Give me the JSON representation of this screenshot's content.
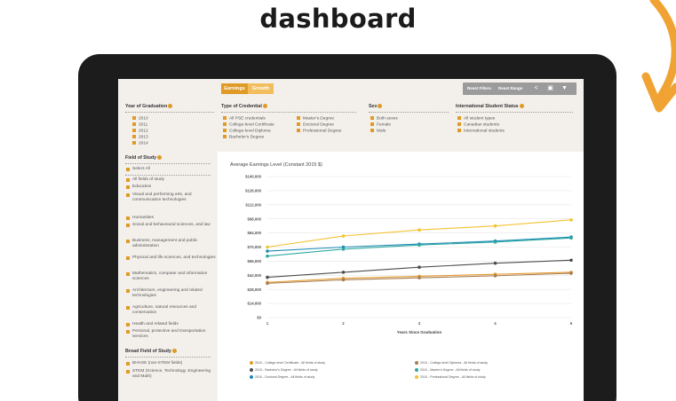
{
  "hero": {
    "title": "dashboard"
  },
  "toolbar": {
    "tabs": [
      {
        "label": "Earnings"
      },
      {
        "label": "Growth"
      }
    ],
    "reset_filters": "Reset Filters",
    "reset_range": "Reset Range",
    "icons": [
      "share-icon",
      "print-icon",
      "download-icon"
    ]
  },
  "filters": {
    "year": {
      "heading": "Year of Graduation",
      "options": [
        "2010",
        "2011",
        "2012",
        "2013",
        "2014"
      ]
    },
    "credential": {
      "heading": "Type of Credential",
      "options": [
        "All PSE credentials",
        "College-level Certificate",
        "College-level Diploma",
        "Bachelor's Degree",
        "Master's Degree",
        "Doctoral Degree",
        "Professional Degree"
      ]
    },
    "sex": {
      "heading": "Sex",
      "options": [
        "Both sexes",
        "Female",
        "Male"
      ]
    },
    "status": {
      "heading": "International Student Status",
      "options": [
        "All student types",
        "Canadian students",
        "International students"
      ]
    }
  },
  "sidebar": {
    "field_heading": "Field of Study",
    "field_options": [
      "Select All",
      "All fields of study",
      "Education",
      "Visual and performing arts, and communication technologies",
      "Humanities",
      "Social and behavioural sciences, and law",
      "Business, management and public administration",
      "Physical and life sciences, and technologies",
      "Mathematics, computer and information sciences",
      "Architecture, engineering and related technologies",
      "Agriculture, natural resources and conservation",
      "Health and related fields",
      "Personal, protective and transportation services"
    ],
    "broad_heading": "Broad Field of Study",
    "broad_options": [
      "BHASE (non-STEM fields)",
      "STEM (Science, Technology, Engineering and Math)"
    ]
  },
  "colors": {
    "accent": "#e09a26",
    "accent_light": "#f2bd5c",
    "panel_bg": "#f3f0ec",
    "laptop": "#1c1c1c",
    "deco_arrow": "#f0a332"
  },
  "chart_data": {
    "type": "line",
    "title": "Average Earnings Level (Constant 2015 $)",
    "xlabel": "Years Since Graduation",
    "ylabel": "",
    "x": [
      1,
      2,
      3,
      4,
      5
    ],
    "ylim": [
      0,
      140000
    ],
    "yticks": [
      0,
      14000,
      28000,
      42000,
      56000,
      70000,
      84000,
      98000,
      112000,
      126000,
      140000
    ],
    "ytick_labels": [
      "$0",
      "$14,000",
      "$28,000",
      "$42,000",
      "$56,000",
      "$70,000",
      "$84,000",
      "$98,000",
      "$112,000",
      "$126,000",
      "$140,000"
    ],
    "grid": true,
    "legend_position": "bottom",
    "series": [
      {
        "name": "2010 - College-level Certificate - All fields of study",
        "color": "#e39a2e",
        "values": [
          35000,
          39000,
          41000,
          43000,
          45000
        ]
      },
      {
        "name": "2010 - Bachelor's Degree - All fields of study",
        "color": "#4d4d4d",
        "values": [
          40000,
          45000,
          50000,
          54000,
          57000
        ]
      },
      {
        "name": "2010 - Doctoral Degree - All fields of study",
        "color": "#1c8ab5",
        "values": [
          66000,
          70000,
          73000,
          76000,
          80000
        ]
      },
      {
        "name": "2010 - College-level Diploma - All fields of study",
        "color": "#a67c52",
        "values": [
          34000,
          37500,
          39500,
          41500,
          44000
        ]
      },
      {
        "name": "2010 - Master's Degree - All fields of study",
        "color": "#2ea8a0",
        "values": [
          61000,
          68000,
          72000,
          75000,
          79000
        ]
      },
      {
        "name": "2010 - Professional Degree - All fields of study",
        "color": "#f2c230",
        "values": [
          70000,
          81000,
          87000,
          91000,
          97000
        ]
      }
    ]
  }
}
